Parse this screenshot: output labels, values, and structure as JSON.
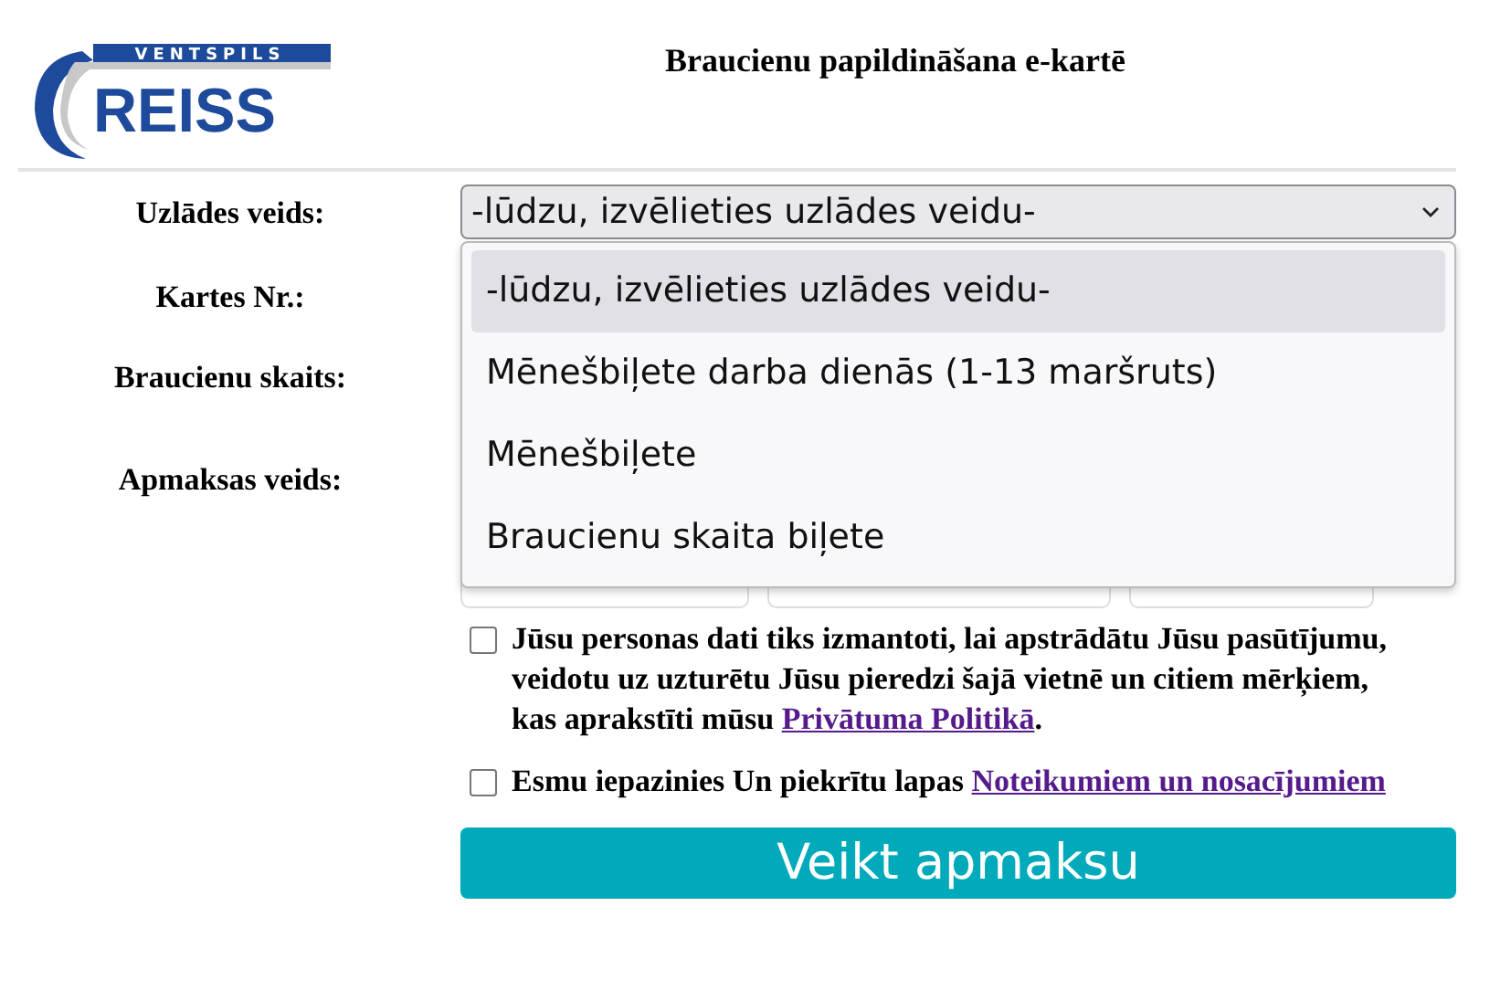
{
  "logo": {
    "top": "VENTSPILS",
    "main": "REISS"
  },
  "title": "Braucienu papildināšana e-kartē",
  "fields": [
    {
      "label": "Uzlādes veids:",
      "kind": "select",
      "value": "-lūdzu, izvēlieties uzlādes veidu-",
      "expanded": true
    },
    {
      "label": "Kartes Nr.:",
      "kind": "hidden"
    },
    {
      "label": "Braucienu skaits:",
      "kind": "hidden"
    },
    {
      "label": "Apmaksas veids:",
      "kind": "payment"
    }
  ],
  "dropdown_options": [
    {
      "label": "-lūdzu, izvēlieties uzlādes veidu-",
      "selected": true
    },
    {
      "label": "Mēnešbiļete darba dienās (1-13 maršruts)",
      "selected": false
    },
    {
      "label": "Mēnešbiļete",
      "selected": false
    },
    {
      "label": "Braucienu skaita biļete",
      "selected": false
    }
  ],
  "consents": [
    {
      "checked": false,
      "text": "Jūsu personas dati tiks izmantoti, lai apstrādātu Jūsu pasūtījumu, veidotu uz uzturētu Jūsu pieredzi šajā vietnē un citiem mērķiem, kas aprakstīti mūsu ",
      "link": "Privātuma Politikā",
      "suffix": "."
    },
    {
      "checked": false,
      "text": "Esmu iepazinies Un piekrītu lapas ",
      "link": "Noteikumiem un nosacījumiem"
    }
  ],
  "submit": "Veikt apmaksu"
}
